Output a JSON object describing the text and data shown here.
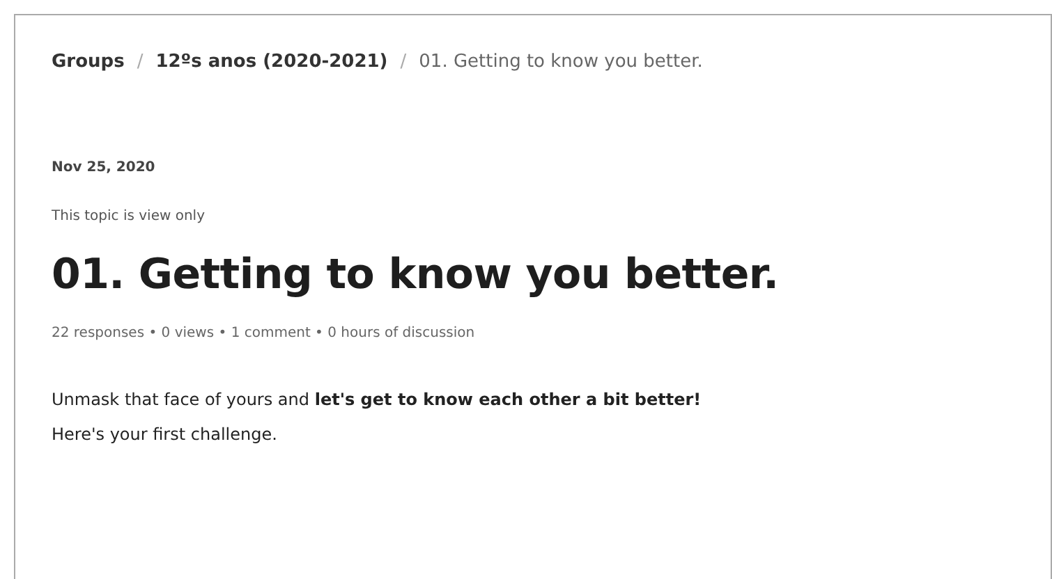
{
  "breadcrumb": [
    {
      "label": "Groups",
      "current": false
    },
    {
      "label": "12ºs anos (2020-2021)",
      "current": false
    },
    {
      "label": "01. Getting to know you better.",
      "current": true
    }
  ],
  "breadcrumb_separator": "/",
  "date": "Nov 25, 2020",
  "notice": "This topic is view only",
  "title": "01. Getting to know you better.",
  "meta": "22 responses • 0 views • 1 comment • 0 hours of discussion",
  "body": [
    "Unmask that face of yours and **let's get to know each other a bit better!**",
    "Here's your first challenge."
  ]
}
